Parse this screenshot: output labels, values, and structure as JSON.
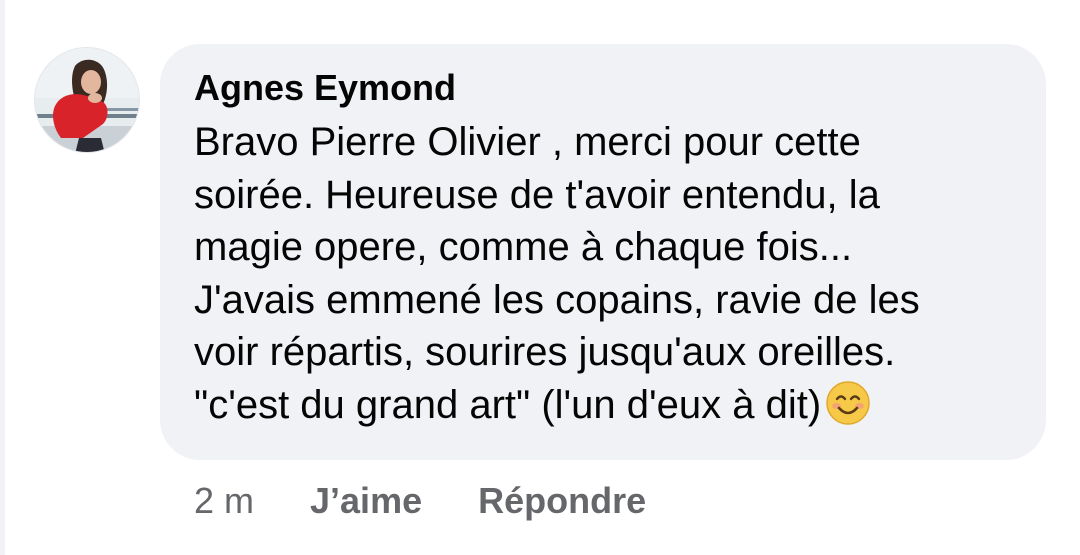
{
  "comment": {
    "author": "Agnes Eymond",
    "text": "Bravo Pierre Olivier , merci pour cette\nsoirée. Heureuse de t'avoir entendu, la\nmagie opere, comme à chaque fois...\nJ'avais emmené les copains, ravie de les\nvoir répartis, sourires jusqu'aux oreilles.\n\"c'est du grand art\" (l'un d'eux à dit)",
    "emoji": "smiling-face-icon",
    "avatar": "profile-photo"
  },
  "actions": {
    "timestamp": "2 m",
    "like_label": "J’aime",
    "reply_label": "Répondre"
  },
  "colors": {
    "bubble_bg": "#f0f2f5",
    "text": "#050505",
    "secondary_text": "#65676b",
    "emoji_yellow": "#f7c948"
  }
}
